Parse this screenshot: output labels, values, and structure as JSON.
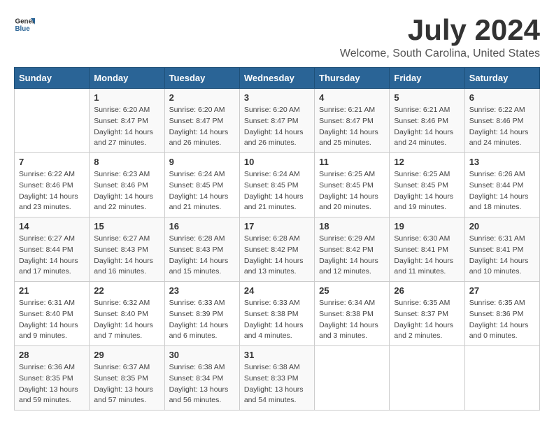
{
  "header": {
    "logo_general": "General",
    "logo_blue": "Blue",
    "title": "July 2024",
    "subtitle": "Welcome, South Carolina, United States"
  },
  "calendar": {
    "days_of_week": [
      "Sunday",
      "Monday",
      "Tuesday",
      "Wednesday",
      "Thursday",
      "Friday",
      "Saturday"
    ],
    "weeks": [
      [
        {
          "day": "",
          "info": ""
        },
        {
          "day": "1",
          "info": "Sunrise: 6:20 AM\nSunset: 8:47 PM\nDaylight: 14 hours\nand 27 minutes."
        },
        {
          "day": "2",
          "info": "Sunrise: 6:20 AM\nSunset: 8:47 PM\nDaylight: 14 hours\nand 26 minutes."
        },
        {
          "day": "3",
          "info": "Sunrise: 6:20 AM\nSunset: 8:47 PM\nDaylight: 14 hours\nand 26 minutes."
        },
        {
          "day": "4",
          "info": "Sunrise: 6:21 AM\nSunset: 8:47 PM\nDaylight: 14 hours\nand 25 minutes."
        },
        {
          "day": "5",
          "info": "Sunrise: 6:21 AM\nSunset: 8:46 PM\nDaylight: 14 hours\nand 24 minutes."
        },
        {
          "day": "6",
          "info": "Sunrise: 6:22 AM\nSunset: 8:46 PM\nDaylight: 14 hours\nand 24 minutes."
        }
      ],
      [
        {
          "day": "7",
          "info": "Sunrise: 6:22 AM\nSunset: 8:46 PM\nDaylight: 14 hours\nand 23 minutes."
        },
        {
          "day": "8",
          "info": "Sunrise: 6:23 AM\nSunset: 8:46 PM\nDaylight: 14 hours\nand 22 minutes."
        },
        {
          "day": "9",
          "info": "Sunrise: 6:24 AM\nSunset: 8:45 PM\nDaylight: 14 hours\nand 21 minutes."
        },
        {
          "day": "10",
          "info": "Sunrise: 6:24 AM\nSunset: 8:45 PM\nDaylight: 14 hours\nand 21 minutes."
        },
        {
          "day": "11",
          "info": "Sunrise: 6:25 AM\nSunset: 8:45 PM\nDaylight: 14 hours\nand 20 minutes."
        },
        {
          "day": "12",
          "info": "Sunrise: 6:25 AM\nSunset: 8:45 PM\nDaylight: 14 hours\nand 19 minutes."
        },
        {
          "day": "13",
          "info": "Sunrise: 6:26 AM\nSunset: 8:44 PM\nDaylight: 14 hours\nand 18 minutes."
        }
      ],
      [
        {
          "day": "14",
          "info": "Sunrise: 6:27 AM\nSunset: 8:44 PM\nDaylight: 14 hours\nand 17 minutes."
        },
        {
          "day": "15",
          "info": "Sunrise: 6:27 AM\nSunset: 8:43 PM\nDaylight: 14 hours\nand 16 minutes."
        },
        {
          "day": "16",
          "info": "Sunrise: 6:28 AM\nSunset: 8:43 PM\nDaylight: 14 hours\nand 15 minutes."
        },
        {
          "day": "17",
          "info": "Sunrise: 6:28 AM\nSunset: 8:42 PM\nDaylight: 14 hours\nand 13 minutes."
        },
        {
          "day": "18",
          "info": "Sunrise: 6:29 AM\nSunset: 8:42 PM\nDaylight: 14 hours\nand 12 minutes."
        },
        {
          "day": "19",
          "info": "Sunrise: 6:30 AM\nSunset: 8:41 PM\nDaylight: 14 hours\nand 11 minutes."
        },
        {
          "day": "20",
          "info": "Sunrise: 6:31 AM\nSunset: 8:41 PM\nDaylight: 14 hours\nand 10 minutes."
        }
      ],
      [
        {
          "day": "21",
          "info": "Sunrise: 6:31 AM\nSunset: 8:40 PM\nDaylight: 14 hours\nand 9 minutes."
        },
        {
          "day": "22",
          "info": "Sunrise: 6:32 AM\nSunset: 8:40 PM\nDaylight: 14 hours\nand 7 minutes."
        },
        {
          "day": "23",
          "info": "Sunrise: 6:33 AM\nSunset: 8:39 PM\nDaylight: 14 hours\nand 6 minutes."
        },
        {
          "day": "24",
          "info": "Sunrise: 6:33 AM\nSunset: 8:38 PM\nDaylight: 14 hours\nand 4 minutes."
        },
        {
          "day": "25",
          "info": "Sunrise: 6:34 AM\nSunset: 8:38 PM\nDaylight: 14 hours\nand 3 minutes."
        },
        {
          "day": "26",
          "info": "Sunrise: 6:35 AM\nSunset: 8:37 PM\nDaylight: 14 hours\nand 2 minutes."
        },
        {
          "day": "27",
          "info": "Sunrise: 6:35 AM\nSunset: 8:36 PM\nDaylight: 14 hours\nand 0 minutes."
        }
      ],
      [
        {
          "day": "28",
          "info": "Sunrise: 6:36 AM\nSunset: 8:35 PM\nDaylight: 13 hours\nand 59 minutes."
        },
        {
          "day": "29",
          "info": "Sunrise: 6:37 AM\nSunset: 8:35 PM\nDaylight: 13 hours\nand 57 minutes."
        },
        {
          "day": "30",
          "info": "Sunrise: 6:38 AM\nSunset: 8:34 PM\nDaylight: 13 hours\nand 56 minutes."
        },
        {
          "day": "31",
          "info": "Sunrise: 6:38 AM\nSunset: 8:33 PM\nDaylight: 13 hours\nand 54 minutes."
        },
        {
          "day": "",
          "info": ""
        },
        {
          "day": "",
          "info": ""
        },
        {
          "day": "",
          "info": ""
        }
      ]
    ]
  }
}
